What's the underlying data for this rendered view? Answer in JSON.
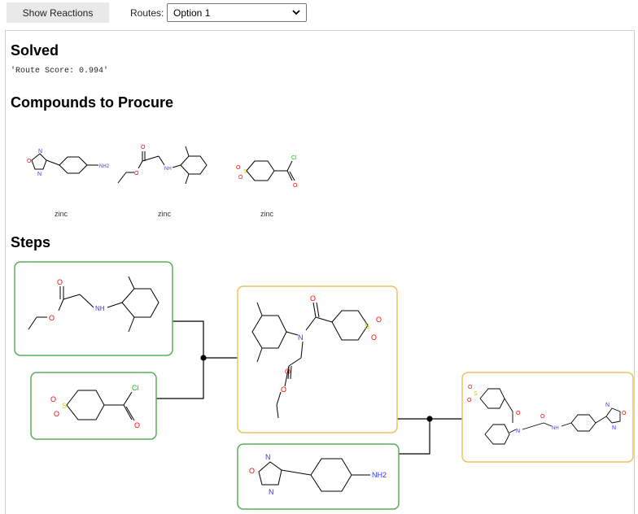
{
  "toolbar": {
    "show_reactions_label": "Show Reactions",
    "routes_label": "Routes:",
    "routes_selected": "Option 1"
  },
  "result": {
    "status_heading": "Solved",
    "route_score": "'Route Score: 0.994'"
  },
  "procure": {
    "heading": "Compounds to Procure",
    "compounds": [
      {
        "source": "zinc",
        "atom_labels": [
          "O",
          "N",
          "N",
          "NH2"
        ]
      },
      {
        "source": "zinc",
        "atom_labels": [
          "O",
          "O",
          "NH"
        ]
      },
      {
        "source": "zinc",
        "atom_labels": [
          "S",
          "O",
          "O",
          "O",
          "Cl"
        ]
      }
    ]
  },
  "steps": {
    "heading": "Steps",
    "molecules": [
      {
        "role": "reactant",
        "atom_labels": [
          "O",
          "O",
          "NH"
        ]
      },
      {
        "role": "reactant",
        "atom_labels": [
          "S",
          "O",
          "O",
          "O",
          "Cl"
        ]
      },
      {
        "role": "intermediate",
        "atom_labels": [
          "N",
          "O",
          "S",
          "O",
          "O",
          "O",
          "O"
        ]
      },
      {
        "role": "reactant",
        "atom_labels": [
          "O",
          "N",
          "N",
          "NH2"
        ]
      },
      {
        "role": "product",
        "atom_labels": [
          "S",
          "O",
          "O",
          "O",
          "N",
          "O",
          "NH",
          "N",
          "O",
          "N"
        ]
      }
    ]
  },
  "colors": {
    "starting_material_border": "#5cad5c",
    "intermediate_border": "#f0c060",
    "oxygen": "#ff0000",
    "nitrogen": "#3333ff",
    "sulfur": "#cccc00",
    "chlorine": "#00cc00"
  }
}
